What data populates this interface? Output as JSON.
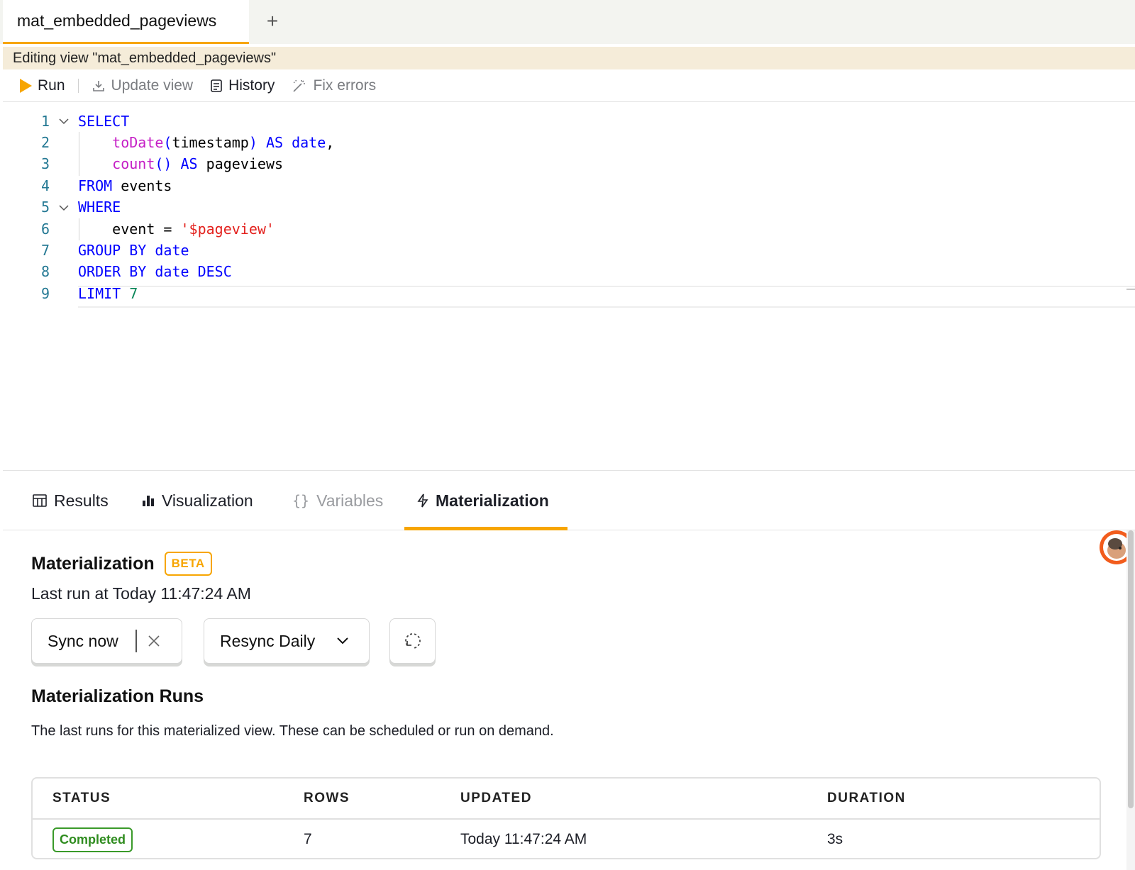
{
  "tabs": {
    "active_label": "mat_embedded_pageviews",
    "add_label": "+"
  },
  "banner": {
    "text": "Editing view \"mat_embedded_pageviews\""
  },
  "toolbar": {
    "run_label": "Run",
    "update_label": "Update view",
    "history_label": "History",
    "fix_label": "Fix errors"
  },
  "editor": {
    "line_numbers": [
      "1",
      "2",
      "3",
      "4",
      "5",
      "6",
      "7",
      "8",
      "9"
    ],
    "lines": [
      [
        {
          "t": "SELECT",
          "c": "kw"
        }
      ],
      [
        {
          "t": "    ",
          "c": "plain"
        },
        {
          "t": "toDate",
          "c": "fn"
        },
        {
          "t": "(",
          "c": "kw"
        },
        {
          "t": "timestamp",
          "c": "plain"
        },
        {
          "t": ") ",
          "c": "kw"
        },
        {
          "t": "AS",
          "c": "kw"
        },
        {
          "t": " ",
          "c": "plain"
        },
        {
          "t": "date",
          "c": "kw"
        },
        {
          "t": ",",
          "c": "plain"
        }
      ],
      [
        {
          "t": "    ",
          "c": "plain"
        },
        {
          "t": "count",
          "c": "fn"
        },
        {
          "t": "() ",
          "c": "kw"
        },
        {
          "t": "AS",
          "c": "kw"
        },
        {
          "t": " pageviews",
          "c": "plain"
        }
      ],
      [
        {
          "t": "FROM",
          "c": "kw"
        },
        {
          "t": " events",
          "c": "plain"
        }
      ],
      [
        {
          "t": "WHERE",
          "c": "kw"
        }
      ],
      [
        {
          "t": "    event = ",
          "c": "plain"
        },
        {
          "t": "'$pageview'",
          "c": "str"
        }
      ],
      [
        {
          "t": "GROUP BY date",
          "c": "kw"
        }
      ],
      [
        {
          "t": "ORDER BY date DESC",
          "c": "kw"
        }
      ],
      [
        {
          "t": "LIMIT",
          "c": "kw"
        },
        {
          "t": " ",
          "c": "plain"
        },
        {
          "t": "7",
          "c": "num"
        }
      ]
    ]
  },
  "result_tabs": {
    "results_label": "Results",
    "visualization_label": "Visualization",
    "variables_label": "Variables",
    "materialization_label": "Materialization"
  },
  "materialization": {
    "title": "Materialization",
    "badge": "BETA",
    "last_run": "Last run at Today 11:47:24 AM",
    "sync_label": "Sync now",
    "resync_label": "Resync Daily",
    "runs_title": "Materialization Runs",
    "runs_description": "The last runs for this materialized view. These can be scheduled or run on demand.",
    "table": {
      "headers": [
        "STATUS",
        "ROWS",
        "UPDATED",
        "DURATION"
      ],
      "rows": [
        {
          "status": "Completed",
          "rows": "7",
          "updated": "Today 11:47:24 AM",
          "duration": "3s"
        }
      ]
    }
  },
  "colors": {
    "accent": "#f7a501",
    "keyword": "#0000ff",
    "function": "#c520c6",
    "string": "#e3211d",
    "success": "#2f8c1f"
  }
}
